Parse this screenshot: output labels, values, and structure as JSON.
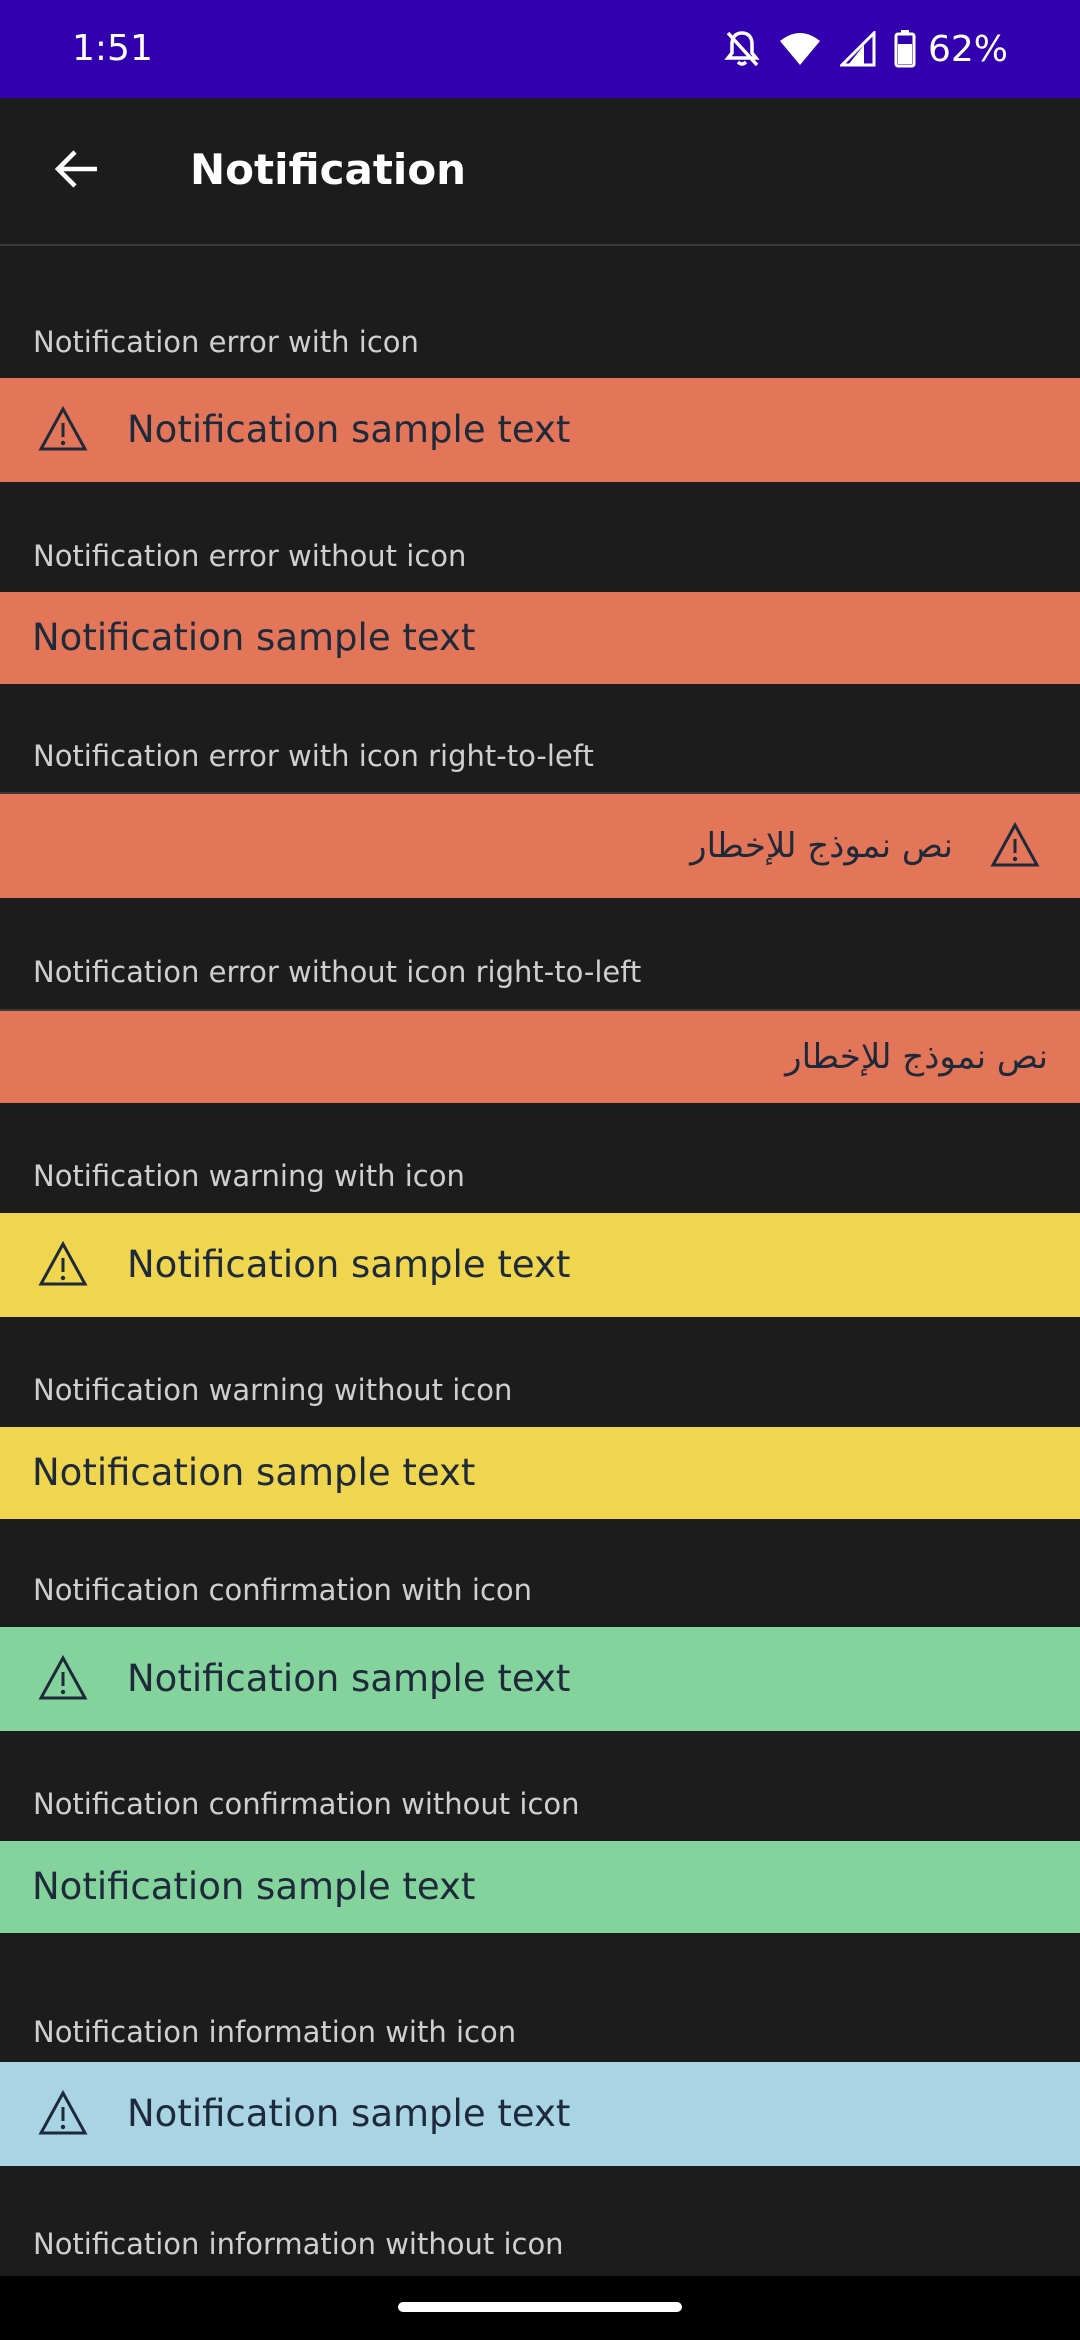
{
  "status_bar": {
    "time": "1:51",
    "battery": "62%",
    "icons": [
      "notifications-off-icon",
      "wifi-icon",
      "signal-icon",
      "battery-icon"
    ]
  },
  "app_bar": {
    "title": "Notification",
    "back_icon": "arrow-back-icon"
  },
  "colors": {
    "error": "#e37559",
    "warning": "#f0d54e",
    "confirmation": "#84d39c",
    "information": "#a8d4e4",
    "background": "#1c1c1d",
    "status_bar": "#3300b0"
  },
  "sections": [
    {
      "label": "Notification error with icon",
      "text": "Notification sample text",
      "icon": "warning-triangle-icon"
    },
    {
      "label": "Notification error without icon",
      "text": "Notification sample text"
    },
    {
      "label": "Notification error with icon right-to-left",
      "text": "نص نموذج للإخطار",
      "icon": "warning-triangle-icon"
    },
    {
      "label": "Notification error without icon right-to-left",
      "text": "نص نموذج للإخطار"
    },
    {
      "label": "Notification warning with icon",
      "text": "Notification sample text",
      "icon": "warning-triangle-icon"
    },
    {
      "label": "Notification warning without icon",
      "text": "Notification sample text"
    },
    {
      "label": "Notification confirmation with icon",
      "text": "Notification sample text",
      "icon": "warning-triangle-icon"
    },
    {
      "label": "Notification confirmation without icon",
      "text": "Notification sample text"
    },
    {
      "label": "Notification information with icon",
      "text": "Notification sample text",
      "icon": "warning-triangle-icon"
    },
    {
      "label": "Notification information without icon"
    }
  ]
}
